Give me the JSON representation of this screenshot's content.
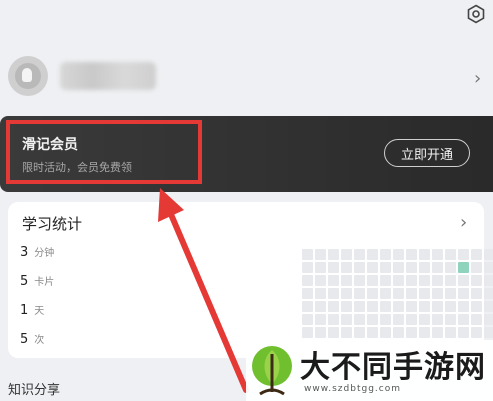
{
  "header": {
    "settings_icon": "gear-icon"
  },
  "profile": {
    "chevron": "›"
  },
  "membership": {
    "title": "滑记会员",
    "subtitle": "限时活动，会员免费领",
    "button_label": "立即开通"
  },
  "stats": {
    "title": "学习统计",
    "chevron": "›",
    "items": [
      {
        "value": "3",
        "unit": "分钟"
      },
      {
        "value": "5",
        "unit": "卡片"
      },
      {
        "value": "1",
        "unit": "天"
      },
      {
        "value": "5",
        "unit": "次"
      }
    ]
  },
  "knowledge": {
    "title": "知识分享"
  },
  "watermark": {
    "title": "大不同手游网",
    "url": "www.szdbtgg.com"
  },
  "colors": {
    "highlight": "#e53935",
    "active_cell": "#8fd3bd",
    "card_dark": "#2f2f2f"
  }
}
